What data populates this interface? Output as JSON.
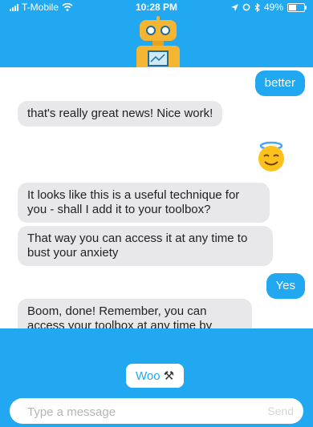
{
  "status": {
    "carrier": "T-Mobile",
    "time": "10:28 PM",
    "battery": "49%"
  },
  "messages": [
    {
      "from": "user",
      "text": "better"
    },
    {
      "from": "bot",
      "text": "that's really great news! Nice work!"
    },
    {
      "from": "user",
      "text": "😇"
    },
    {
      "from": "bot",
      "text": "It looks like this is a useful technique for you - shall I add it to your toolbox?"
    },
    {
      "from": "bot",
      "text": "That way you can access it at any time to bust your anxiety"
    },
    {
      "from": "user",
      "text": "Yes"
    },
    {
      "from": "bot",
      "text": "Boom, done! Remember, you can access your toolbox at any time by typing 'toolbox'"
    }
  ],
  "quick_reply": {
    "label": "Woo",
    "icon": "⚒"
  },
  "composer": {
    "placeholder": "Type a message",
    "send_label": "Send"
  },
  "colors": {
    "accent": "#21a8f0",
    "bot_bubble": "#e8e8ea",
    "robot": "#f4b532"
  }
}
